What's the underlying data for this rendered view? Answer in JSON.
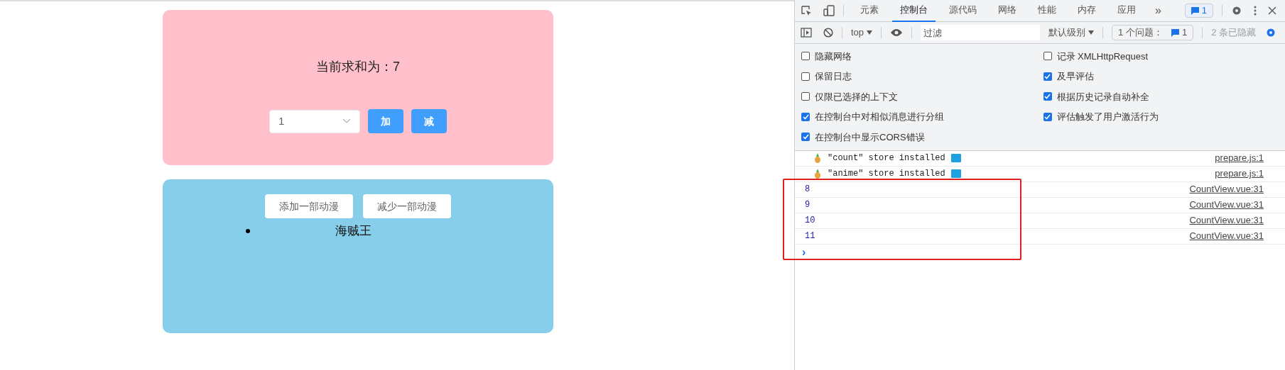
{
  "page": {
    "counter": {
      "sum_label": "当前求和为：7",
      "select": {
        "value": "1"
      },
      "buttons": [
        "加",
        "减"
      ]
    },
    "anime": {
      "buttons": [
        "添加一部动漫",
        "减少一部动漫"
      ],
      "list": [
        "海贼王"
      ]
    }
  },
  "devtools": {
    "tabs": [
      {
        "label": "元素",
        "selected": false
      },
      {
        "label": "控制台",
        "selected": true
      },
      {
        "label": "源代码",
        "selected": false
      },
      {
        "label": "网络",
        "selected": false
      },
      {
        "label": "性能",
        "selected": false
      },
      {
        "label": "内存",
        "selected": false
      },
      {
        "label": "应用",
        "selected": false
      }
    ],
    "more": "»",
    "issues_badge": "1",
    "console_toolbar": {
      "context": "top",
      "filter_placeholder": "过滤",
      "level": "默认级别",
      "issues": "1 个问题：",
      "issues_count": "1",
      "hidden": "2 条已隐藏"
    },
    "settings": [
      {
        "label": "隐藏网络",
        "checked": false
      },
      {
        "label": "记录 XMLHttpRequest",
        "checked": false
      },
      {
        "label": "保留日志",
        "checked": false
      },
      {
        "label": "及早评估",
        "checked": true
      },
      {
        "label": "仅限已选择的上下文",
        "checked": false
      },
      {
        "label": "根据历史记录自动补全",
        "checked": true
      },
      {
        "label": "在控制台中对相似消息进行分组",
        "checked": true
      },
      {
        "label": "评估触发了用户激活行为",
        "checked": true
      },
      {
        "label": "在控制台中显示CORS错误",
        "checked": true
      }
    ],
    "messages": [
      {
        "kind": "store",
        "text": "\"count\" store installed",
        "source": "prepare.js:1"
      },
      {
        "kind": "store",
        "text": "\"anime\" store installed",
        "source": "prepare.js:1"
      },
      {
        "kind": "number",
        "text": "8",
        "source": "CountView.vue:31"
      },
      {
        "kind": "number",
        "text": "9",
        "source": "CountView.vue:31"
      },
      {
        "kind": "number",
        "text": "10",
        "source": "CountView.vue:31"
      },
      {
        "kind": "number",
        "text": "11",
        "source": "CountView.vue:31"
      }
    ],
    "prompt": "›"
  }
}
